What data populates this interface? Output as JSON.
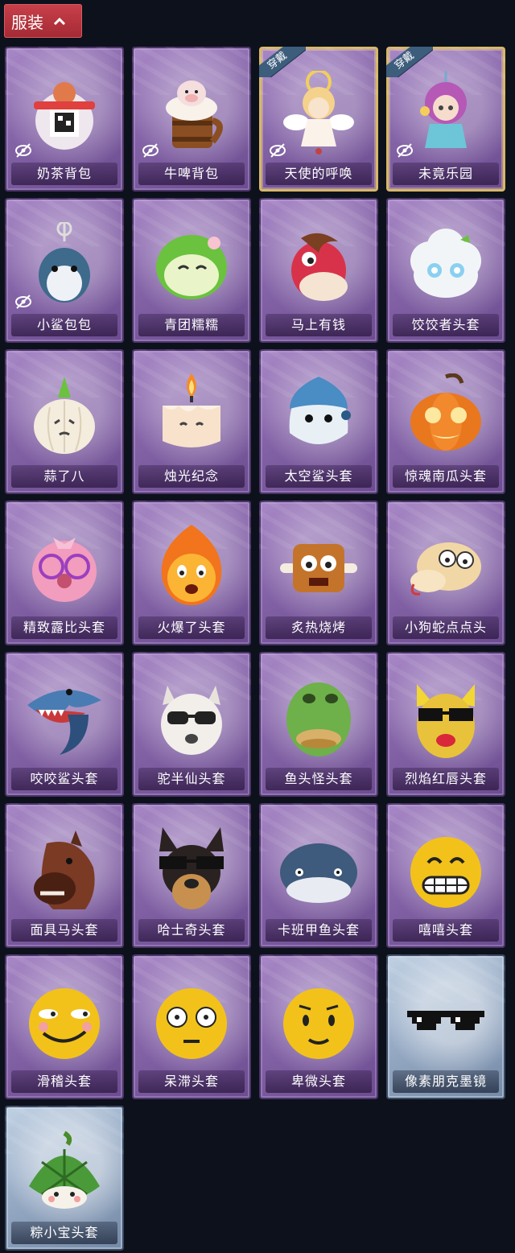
{
  "header": {
    "tab_label": "服装"
  },
  "equipped_badge": "穿戴",
  "items": [
    {
      "name": "奶茶背包",
      "icon": "milk-tea-backpack-icon",
      "hidden": true,
      "equipped": false,
      "rarity": "purple"
    },
    {
      "name": "牛啤背包",
      "icon": "cow-beer-mug-backpack-icon",
      "hidden": true,
      "equipped": false,
      "rarity": "purple"
    },
    {
      "name": "天使的呼唤",
      "icon": "angel-figure-icon",
      "hidden": true,
      "equipped": true,
      "rarity": "purple"
    },
    {
      "name": "未竟乐园",
      "icon": "pink-hair-girl-figure-icon",
      "hidden": true,
      "equipped": true,
      "rarity": "purple"
    },
    {
      "name": "小鲨包包",
      "icon": "shark-bag-icon",
      "hidden": true,
      "equipped": false,
      "rarity": "purple"
    },
    {
      "name": "青团糯糯",
      "icon": "green-rice-ball-icon",
      "hidden": false,
      "equipped": false,
      "rarity": "purple"
    },
    {
      "name": "马上有钱",
      "icon": "red-horse-head-icon",
      "hidden": false,
      "equipped": false,
      "rarity": "purple"
    },
    {
      "name": "饺饺者头套",
      "icon": "dumpling-cloud-head-icon",
      "hidden": false,
      "equipped": false,
      "rarity": "purple"
    },
    {
      "name": "蒜了八",
      "icon": "garlic-head-icon",
      "hidden": false,
      "equipped": false,
      "rarity": "purple"
    },
    {
      "name": "烛光纪念",
      "icon": "candle-head-icon",
      "hidden": false,
      "equipped": false,
      "rarity": "purple"
    },
    {
      "name": "太空鲨头套",
      "icon": "space-shark-head-icon",
      "hidden": false,
      "equipped": false,
      "rarity": "purple"
    },
    {
      "name": "惊魂南瓜头套",
      "icon": "pumpkin-head-icon",
      "hidden": false,
      "equipped": false,
      "rarity": "purple"
    },
    {
      "name": "精致露比头套",
      "icon": "pink-beaver-glasses-head-icon",
      "hidden": false,
      "equipped": false,
      "rarity": "purple"
    },
    {
      "name": "火爆了头套",
      "icon": "fire-head-icon",
      "hidden": false,
      "equipped": false,
      "rarity": "purple"
    },
    {
      "name": "炙热烧烤",
      "icon": "bbq-meat-head-icon",
      "hidden": false,
      "equipped": false,
      "rarity": "purple"
    },
    {
      "name": "小狗蛇点点头",
      "icon": "snake-dog-head-icon",
      "hidden": false,
      "equipped": false,
      "rarity": "purple"
    },
    {
      "name": "咬咬鲨头套",
      "icon": "biting-shark-head-icon",
      "hidden": false,
      "equipped": false,
      "rarity": "purple"
    },
    {
      "name": "驼半仙头套",
      "icon": "alpaca-sunglasses-head-icon",
      "hidden": false,
      "equipped": false,
      "rarity": "purple"
    },
    {
      "name": "鱼头怪头套",
      "icon": "fish-monster-head-icon",
      "hidden": false,
      "equipped": false,
      "rarity": "purple"
    },
    {
      "name": "烈焰红唇头套",
      "icon": "yellow-red-lips-head-icon",
      "hidden": false,
      "equipped": false,
      "rarity": "purple"
    },
    {
      "name": "面具马头套",
      "icon": "horse-mask-head-icon",
      "hidden": false,
      "equipped": false,
      "rarity": "purple"
    },
    {
      "name": "哈士奇头套",
      "icon": "husky-sunglasses-head-icon",
      "hidden": false,
      "equipped": false,
      "rarity": "purple"
    },
    {
      "name": "卡班甲鱼头套",
      "icon": "blue-fish-head-icon",
      "hidden": false,
      "equipped": false,
      "rarity": "purple"
    },
    {
      "name": "嘻嘻头套",
      "icon": "grinning-emoji-head-icon",
      "hidden": false,
      "equipped": false,
      "rarity": "purple"
    },
    {
      "name": "滑稽头套",
      "icon": "sly-smile-emoji-head-icon",
      "hidden": false,
      "equipped": false,
      "rarity": "purple"
    },
    {
      "name": "呆滞头套",
      "icon": "blank-stare-emoji-head-icon",
      "hidden": false,
      "equipped": false,
      "rarity": "purple"
    },
    {
      "name": "卑微头套",
      "icon": "humble-emoji-head-icon",
      "hidden": false,
      "equipped": false,
      "rarity": "purple"
    },
    {
      "name": "像素朋克墨镜",
      "icon": "pixel-sunglasses-icon",
      "hidden": false,
      "equipped": false,
      "rarity": "blue"
    },
    {
      "name": "粽小宝头套",
      "icon": "zongzi-head-icon",
      "hidden": false,
      "equipped": false,
      "rarity": "blue"
    }
  ]
}
